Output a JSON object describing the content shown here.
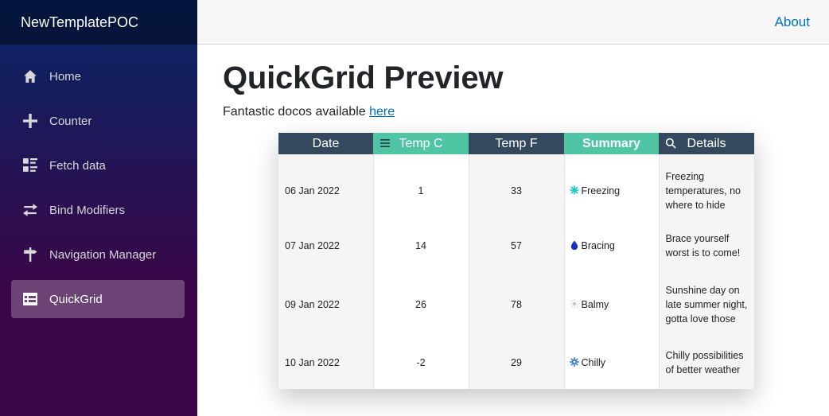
{
  "app": {
    "brand": "NewTemplatePOC"
  },
  "nav": {
    "items": [
      {
        "label": "Home",
        "icon": "home-icon"
      },
      {
        "label": "Counter",
        "icon": "plus-icon"
      },
      {
        "label": "Fetch data",
        "icon": "list-rich-icon"
      },
      {
        "label": "Bind Modifiers",
        "icon": "swap-icon"
      },
      {
        "label": "Navigation Manager",
        "icon": "signpost-icon"
      },
      {
        "label": "QuickGrid",
        "icon": "table-icon",
        "active": true
      }
    ]
  },
  "top_row": {
    "about_label": "About"
  },
  "page": {
    "title": "QuickGrid Preview",
    "intro_text": "Fantastic docos available ",
    "intro_link": "here"
  },
  "grid": {
    "columns": [
      "Date",
      "Temp C",
      "Temp F",
      "Summary",
      "Details"
    ],
    "rows": [
      {
        "date": "06 Jan 2022",
        "temp_c": "1",
        "temp_f": "33",
        "summary": "Freezing",
        "summary_icon": "snowflake-icon",
        "details": "Freezing temperatures, no where to hide"
      },
      {
        "date": "07 Jan 2022",
        "temp_c": "14",
        "temp_f": "57",
        "summary": "Bracing",
        "summary_icon": "droplet-icon",
        "details": "Brace yourself worst is to come!"
      },
      {
        "date": "09 Jan 2022",
        "temp_c": "26",
        "temp_f": "78",
        "summary": "Balmy",
        "summary_icon": "sun-icon",
        "details": "Sunshine day on late summer night, gotta love those"
      },
      {
        "date": "10 Jan 2022",
        "temp_c": "-2",
        "temp_f": "29",
        "summary": "Chilly",
        "summary_icon": "gear-icon",
        "details": "Chilly possibilities of better weather"
      }
    ]
  },
  "colors": {
    "header_dark": "#34495e",
    "header_teal": "#4fc5a3",
    "link": "#0071c1",
    "sidebar_top": "#052767",
    "sidebar_bottom": "#3a0647"
  }
}
